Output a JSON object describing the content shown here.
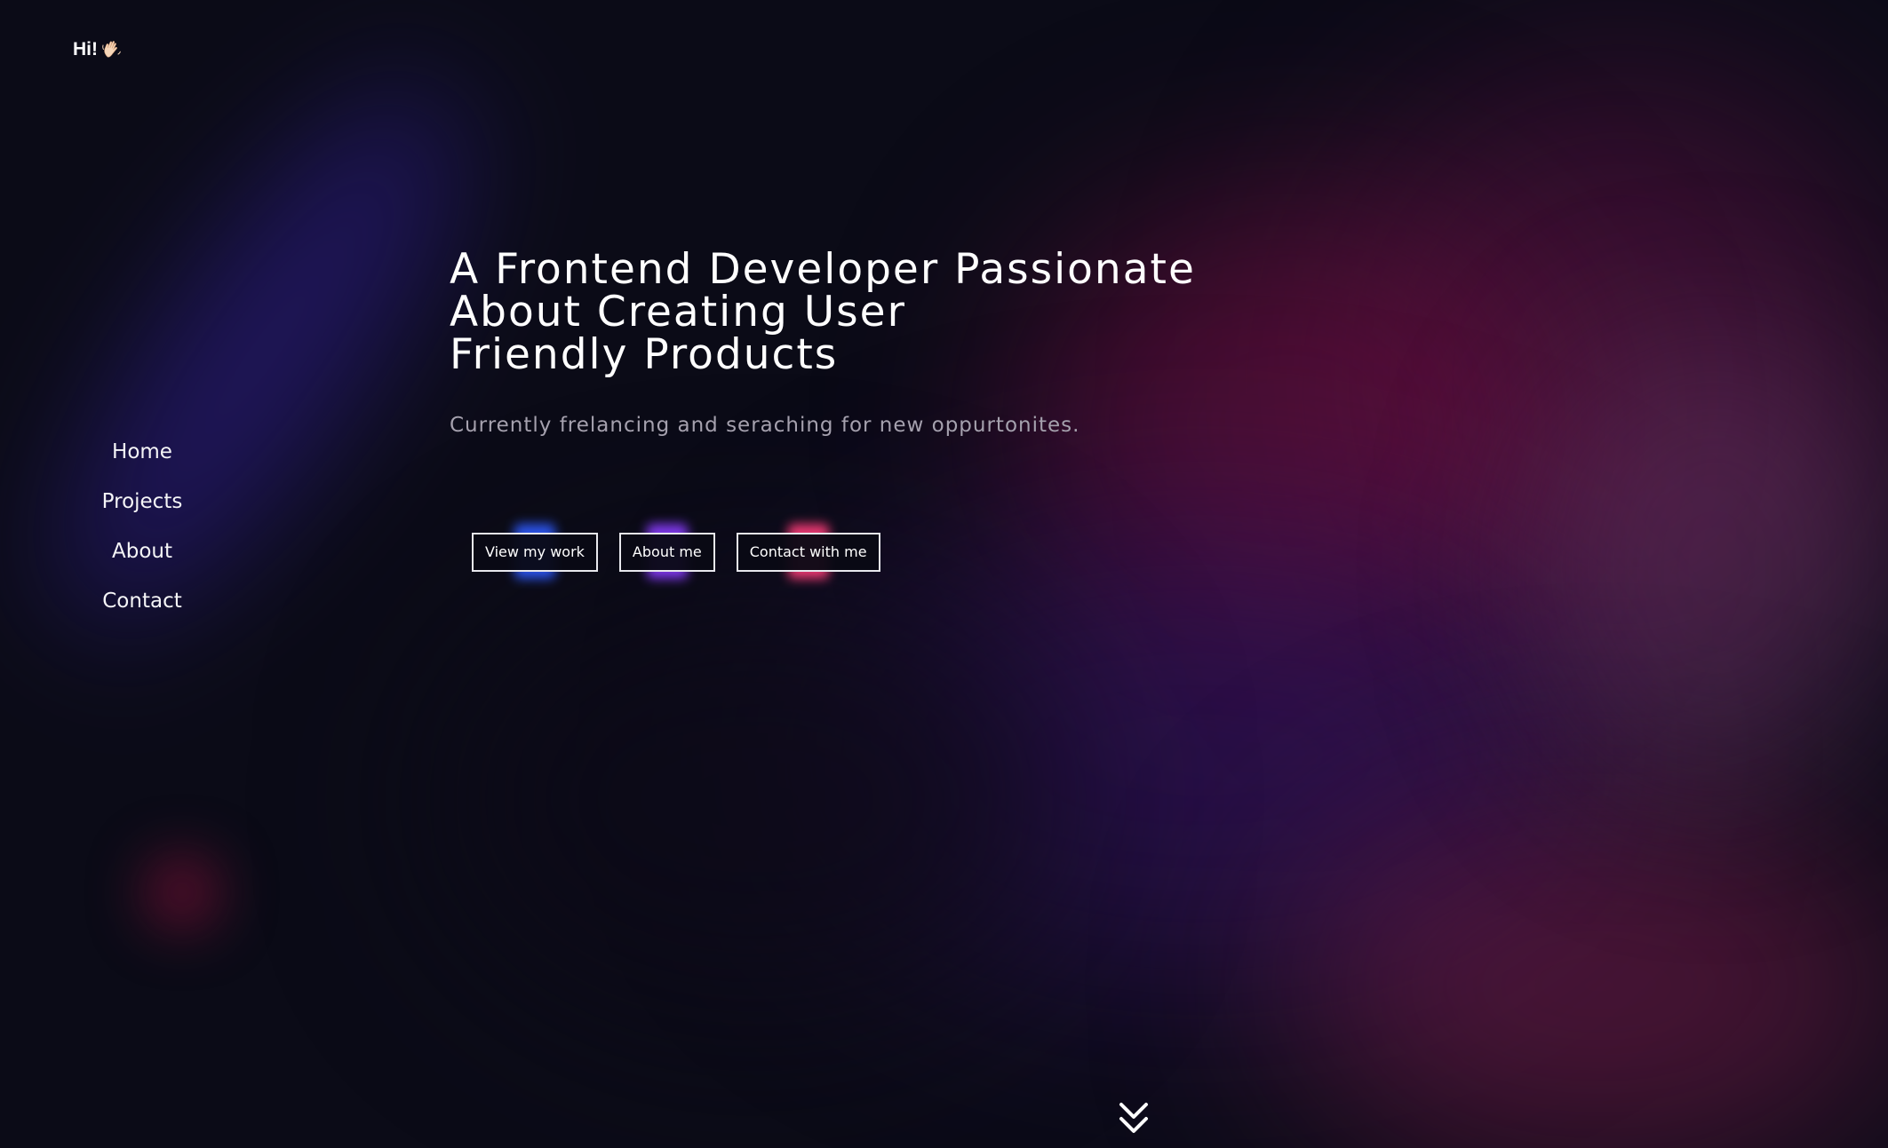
{
  "header": {
    "logo_text": "Hi!",
    "logo_icon": "waving-hand-icon"
  },
  "nav": {
    "items": [
      {
        "label": "Home"
      },
      {
        "label": "Projects"
      },
      {
        "label": "About"
      },
      {
        "label": "Contact"
      }
    ]
  },
  "hero": {
    "title_line1": "A Frontend Developer Passionate",
    "title_line2": "About Creating User",
    "title_line3": "Friendly Products",
    "subtitle": "Currently frelancing and seraching for new oppurtonites."
  },
  "buttons": {
    "view_work": {
      "label": "View my work",
      "glow_color": "#2f5bff"
    },
    "about_me": {
      "label": "About me",
      "glow_color": "#8a3dff"
    },
    "contact": {
      "label": "Contact with me",
      "glow_color": "#ff3d7a"
    }
  },
  "scroll": {
    "icon": "double-chevron-down-icon"
  },
  "colors": {
    "background": "#0b0b17",
    "text": "#ffffff",
    "subtitle": "#a5a1ae"
  }
}
